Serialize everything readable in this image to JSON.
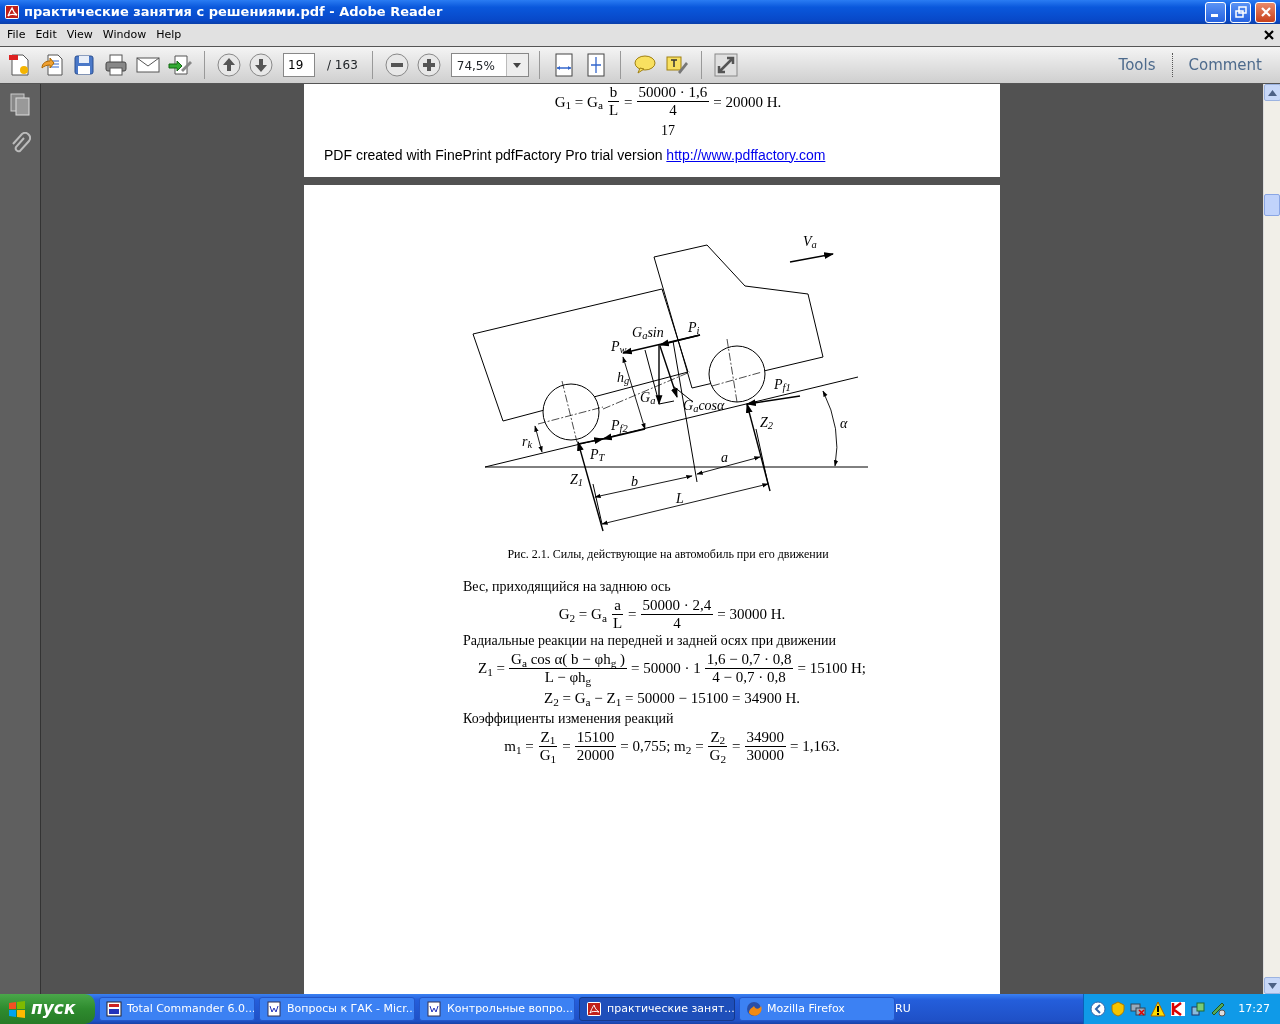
{
  "window": {
    "title": "практические занятия с решениями.pdf - Adobe Reader"
  },
  "menu": [
    {
      "label": "File"
    },
    {
      "label": "Edit"
    },
    {
      "label": "View"
    },
    {
      "label": "Window"
    },
    {
      "label": "Help"
    }
  ],
  "toolbar": {
    "page": "19",
    "page_count": "/ 163",
    "zoom": "74,5%",
    "panels": [
      {
        "label": "Tools"
      },
      {
        "label": "Comment"
      }
    ]
  },
  "document": {
    "previous_page": {
      "formula": [
        {
          "kind": "text",
          "text": "G$_{1}$ = G$_{a}$"
        },
        {
          "kind": "frac",
          "num": "b",
          "den": "L"
        },
        {
          "kind": "text",
          "text": "="
        },
        {
          "kind": "frac",
          "num": "50000 · 1,6",
          "den": "4"
        },
        {
          "kind": "text",
          "text": "= 20000 Н."
        }
      ],
      "page_number": "17",
      "footer": "PDF created with FinePrint pdfFactory Pro trial version",
      "footer_link": "http://www.pdffactory.com"
    },
    "page": {
      "figure": {
        "labels": [
          {
            "text": "V$_{a}$"
          },
          {
            "text": "G$_{a}$sin"
          },
          {
            "text": "P$_{i}$"
          },
          {
            "text": "P$_{w}$"
          },
          {
            "text": "h$_{g}$"
          },
          {
            "text": "G$_{a}$"
          },
          {
            "text": "G$_{a}$cosα"
          },
          {
            "text": "P$_{f1}$"
          },
          {
            "text": "Z$_{2}$"
          },
          {
            "text": "α"
          },
          {
            "text": "r$_{k}$"
          },
          {
            "text": "P$_{T}$"
          },
          {
            "text": "P$_{f2}$"
          },
          {
            "text": "a"
          },
          {
            "text": "Z$_{1}$"
          },
          {
            "text": "b"
          },
          {
            "text": "L"
          }
        ],
        "caption": "Рис. 2.1. Силы, действующие на автомобиль при его движении"
      },
      "blocks": [
        {
          "kind": "paragraph",
          "text": "Вес, приходящийся на заднюю ось"
        },
        {
          "kind": "formula",
          "parts": [
            {
              "kind": "text",
              "text": "G$_{2}$ = G$_{a}$"
            },
            {
              "kind": "frac",
              "num": "a",
              "den": "L"
            },
            {
              "kind": "text",
              "text": "="
            },
            {
              "kind": "frac",
              "num": "50000 · 2,4",
              "den": "4"
            },
            {
              "kind": "text",
              "text": "= 30000 Н."
            }
          ]
        },
        {
          "kind": "paragraph",
          "text": "Радиальные реакции на передней и задней осях при движении"
        },
        {
          "kind": "formula",
          "parts": [
            {
              "kind": "text",
              "text": "Z$_{1}$ ="
            },
            {
              "kind": "frac",
              "num": "G$_{a}$ cos α( b − φh$_{g}$ )",
              "den": "L − φh$_{g}$"
            },
            {
              "kind": "text",
              "text": "= 50000 · 1"
            },
            {
              "kind": "frac",
              "num": "1,6 − 0,7 · 0,8",
              "den": "4 − 0,7 · 0,8"
            },
            {
              "kind": "text",
              "text": "= 15100 Н;"
            }
          ]
        },
        {
          "kind": "formula",
          "parts": [
            {
              "kind": "text",
              "text": "Z$_{2}$ = G$_{a}$ − Z$_{1}$ = 50000 − 15100 = 34900 Н."
            }
          ]
        },
        {
          "kind": "paragraph",
          "text": "Коэффициенты изменения реакций"
        },
        {
          "kind": "formula",
          "parts": [
            {
              "kind": "text",
              "text": "m$_{1}$ ="
            },
            {
              "kind": "frac",
              "num": "Z$_{1}$",
              "den": "G$_{1}$"
            },
            {
              "kind": "text",
              "text": "="
            },
            {
              "kind": "frac",
              "num": "15100",
              "den": "20000"
            },
            {
              "kind": "text",
              "text": "= 0,755; m$_{2}$ ="
            },
            {
              "kind": "frac",
              "num": "Z$_{2}$",
              "den": "G$_{2}$"
            },
            {
              "kind": "text",
              "text": "="
            },
            {
              "kind": "frac",
              "num": "34900",
              "den": "30000"
            },
            {
              "kind": "text",
              "text": "= 1,163."
            }
          ]
        }
      ]
    }
  },
  "taskbar": {
    "start": "пуск",
    "tasks": [
      {
        "label": "Total Commander 6.0...",
        "selected": false
      },
      {
        "label": "Вопросы к ГАК - Micr...",
        "selected": false
      },
      {
        "label": "Контрольные вопро...",
        "selected": false
      },
      {
        "label": "практические занят...",
        "selected": true
      },
      {
        "label": "Mozilla Firefox",
        "selected": false
      }
    ],
    "language": "RU",
    "clock": "17:27"
  }
}
